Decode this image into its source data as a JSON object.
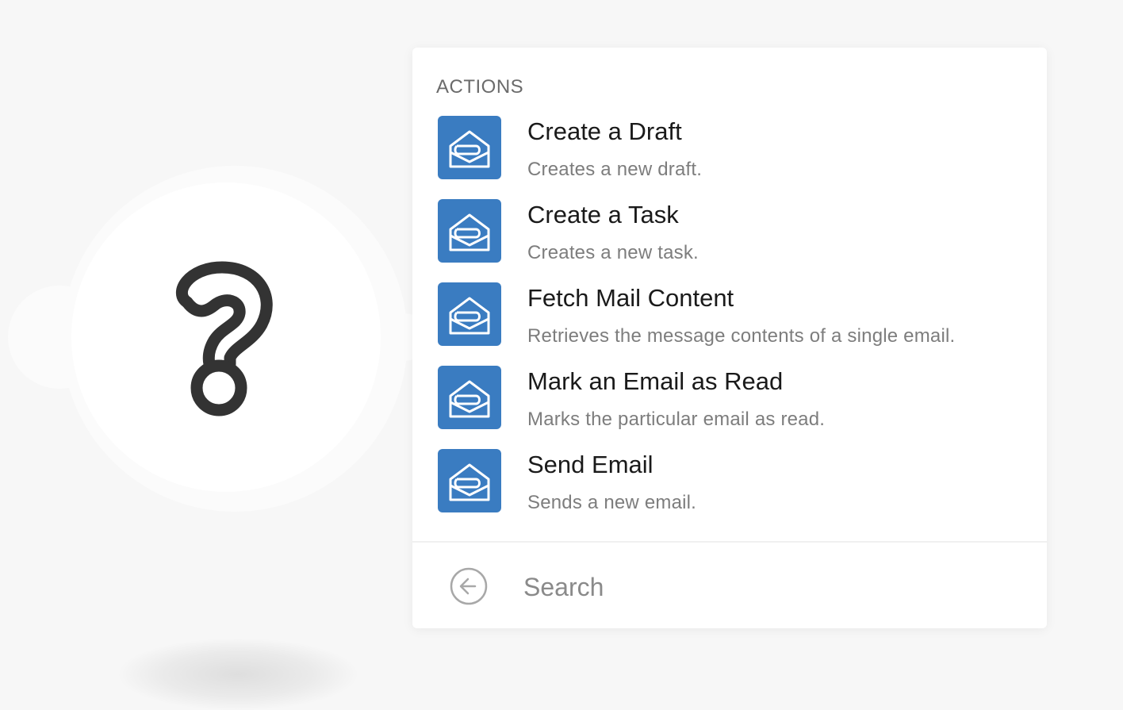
{
  "canvas": {
    "module_icon": "question-mark-icon"
  },
  "panel": {
    "section_label": "ACTIONS",
    "actions": [
      {
        "title": "Create a Draft",
        "description": "Creates a new draft.",
        "icon": "mail-open-icon"
      },
      {
        "title": "Create a Task",
        "description": "Creates a new task.",
        "icon": "mail-open-icon"
      },
      {
        "title": "Fetch Mail Content",
        "description": "Retrieves the message contents of a single email.",
        "icon": "mail-open-icon"
      },
      {
        "title": "Mark an Email as Read",
        "description": "Marks the particular email as read.",
        "icon": "mail-open-icon"
      },
      {
        "title": "Send Email",
        "description": "Sends a new email.",
        "icon": "mail-open-icon"
      }
    ],
    "footer": {
      "back_icon": "arrow-left-circle-icon",
      "search_placeholder": "Search",
      "search_value": ""
    }
  },
  "colors": {
    "app_icon_bg": "#3a7cc1",
    "canvas_bg": "#f7f7f7",
    "title_text": "#1a1a1a",
    "muted_text": "#7d7d7d"
  }
}
